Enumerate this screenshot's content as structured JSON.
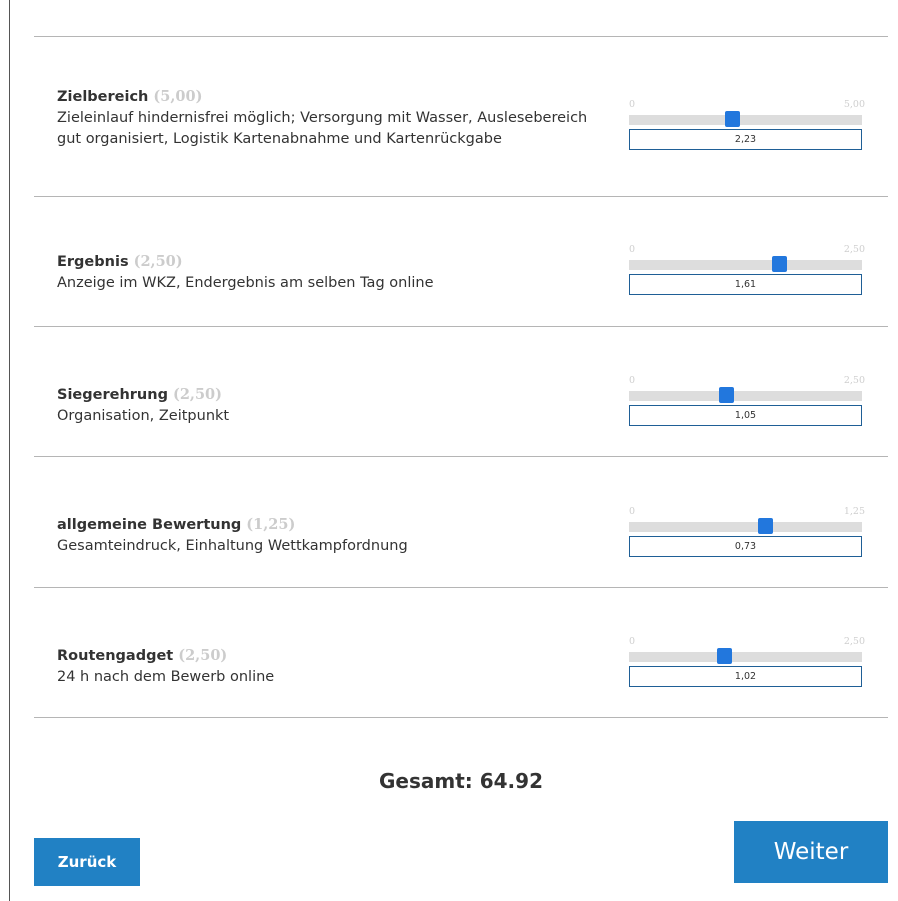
{
  "items": [
    {
      "title": "Zielbereich",
      "max": "(5,00)",
      "description": "Zieleinlauf hindernisfrei möglich; Versorgung mit Wasser, Auslesebereich gut organisiert, Logistik Kartenabnahme und Kartenrückgabe",
      "range_min": "0",
      "range_max": "5,00",
      "value": "2,23",
      "fraction": 0.446
    },
    {
      "title": "Ergebnis",
      "max": "(2,50)",
      "description": "Anzeige im WKZ, Endergebnis am selben Tag online",
      "range_min": "0",
      "range_max": "2,50",
      "value": "1,61",
      "fraction": 0.644
    },
    {
      "title": "Siegerehrung",
      "max": "(2,50)",
      "description": "Organisation, Zeitpunkt",
      "range_min": "0",
      "range_max": "2,50",
      "value": "1,05",
      "fraction": 0.42
    },
    {
      "title": "allgemeine Bewertung",
      "max": "(1,25)",
      "description": "Gesamteindruck, Einhaltung Wettkampfordnung",
      "range_min": "0",
      "range_max": "1,25",
      "value": "0,73",
      "fraction": 0.584
    },
    {
      "title": "Routengadget",
      "max": "(2,50)",
      "description": "24 h nach dem Bewerb online",
      "range_min": "0",
      "range_max": "2,50",
      "value": "1,02",
      "fraction": 0.408
    }
  ],
  "total_label": "Gesamt: 64.92",
  "buttons": {
    "back_label": "Zurück",
    "next_label": "Weiter"
  },
  "colors": {
    "accent": "#2181c4",
    "handle": "#2277dd",
    "track": "#dddddd",
    "max_hint": "#cccccc"
  }
}
